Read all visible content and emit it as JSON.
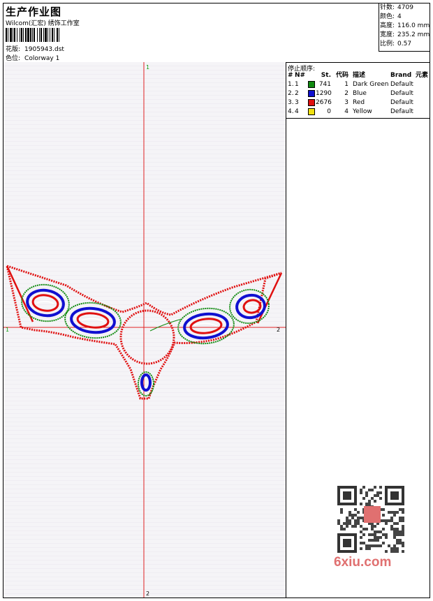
{
  "header": {
    "title": "生产作业图",
    "studio": "Wilcom(汇宏) 绣饰工作室",
    "design_label": "花版:",
    "design_file": "1905943.dst",
    "colorway_label": "色位:",
    "colorway": "Colorway 1"
  },
  "meta": {
    "stitches_label": "针数:",
    "stitches": "4709",
    "colors_label": "颜色:",
    "colors": "4",
    "height_label": "高度:",
    "height": "116.0 mm",
    "width_label": "宽度:",
    "width": "235.2 mm",
    "scale_label": "比例:",
    "scale": "0.57"
  },
  "axes": {
    "top": "1",
    "left": "1",
    "right": "2",
    "bottom": "2"
  },
  "stop_sequence": {
    "caption": "停止顺序:",
    "headers": {
      "idx": "#",
      "no": "N#",
      "st": "St.",
      "code": "代码",
      "desc": "描述",
      "brand": "Brand",
      "elem": "元素"
    },
    "rows": [
      {
        "idx": "1.",
        "no": "1",
        "color": "#108a10",
        "st": "741",
        "code": "1",
        "desc": "Dark Green",
        "brand": "Default"
      },
      {
        "idx": "2.",
        "no": "2",
        "color": "#1010d0",
        "st": "1290",
        "code": "2",
        "desc": "Blue",
        "brand": "Default"
      },
      {
        "idx": "3.",
        "no": "3",
        "color": "#e01010",
        "st": "2676",
        "code": "3",
        "desc": "Red",
        "brand": "Default"
      },
      {
        "idx": "4.",
        "no": "4",
        "color": "#f0e010",
        "st": "0",
        "code": "4",
        "desc": "Yellow",
        "brand": "Default"
      }
    ]
  },
  "watermark": {
    "brand": "6xiu.com"
  }
}
